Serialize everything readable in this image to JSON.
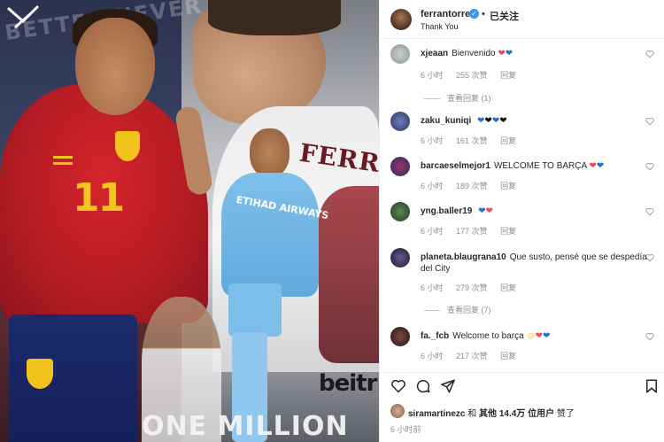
{
  "media": {
    "image_alt": "Ferran Torres Spain / Manchester City graphic",
    "jersey_number": "11",
    "overlay_top_text": "BETTER NEVER STOPS",
    "shirt_text": "FERR",
    "sponsor_text": "ETIHAD AIRWAYS",
    "sponsor_bottom": "beitr",
    "bottom_text": "ONE MILLION"
  },
  "header": {
    "username": "ferrantorres",
    "follow_status": "已关注",
    "subtitle": "Thank You",
    "separator": "•"
  },
  "comments": [
    {
      "username": "xjeaan",
      "text": "Bienvenido",
      "emojis": [
        "red-heart",
        "blue-heart"
      ],
      "time": "6 小时",
      "likes": "255 次赞",
      "reply_label": "回复",
      "view_replies": "查看回复 (1)"
    },
    {
      "username": "zaku_kuniqi",
      "text": "",
      "emojis": [
        "blue-heart",
        "black-heart",
        "blue-heart",
        "black-heart"
      ],
      "time": "6 小时",
      "likes": "161 次赞",
      "reply_label": "回复",
      "view_replies": ""
    },
    {
      "username": "barcaeselmejor1",
      "text": "WELCOME TO BARÇA",
      "emojis": [
        "red-heart",
        "blue-heart"
      ],
      "time": "6 小时",
      "likes": "189 次赞",
      "reply_label": "回复",
      "view_replies": ""
    },
    {
      "username": "yng.baller19",
      "text": "",
      "emojis": [
        "blue-heart",
        "red-heart"
      ],
      "time": "6 小时",
      "likes": "177 次赞",
      "reply_label": "回复",
      "view_replies": ""
    },
    {
      "username": "planeta.blaugrana10",
      "text": "Que susto, pensé que se despedía del City",
      "emojis": [],
      "time": "6 小时",
      "likes": "279 次赞",
      "reply_label": "回复",
      "view_replies": "查看回复 (7)"
    },
    {
      "username": "fa._fcb",
      "text": "Welcome to barça",
      "emojis": [
        "smile",
        "red-heart",
        "blue-heart"
      ],
      "time": "6 小时",
      "likes": "217 次赞",
      "reply_label": "回复",
      "view_replies": ""
    }
  ],
  "likes_summary": {
    "liker": "siramartinezc",
    "mid": "和",
    "others_label": "其他",
    "count": "14.4万",
    "suffix": "位用户",
    "tail": "赞了"
  },
  "post_time": "6 小时前",
  "colors": {
    "text": "#262626",
    "muted": "#8e8e8e",
    "verified_blue": "#3797f0",
    "red_heart": "#ed4956",
    "blue_heart": "#1f6fd6"
  }
}
